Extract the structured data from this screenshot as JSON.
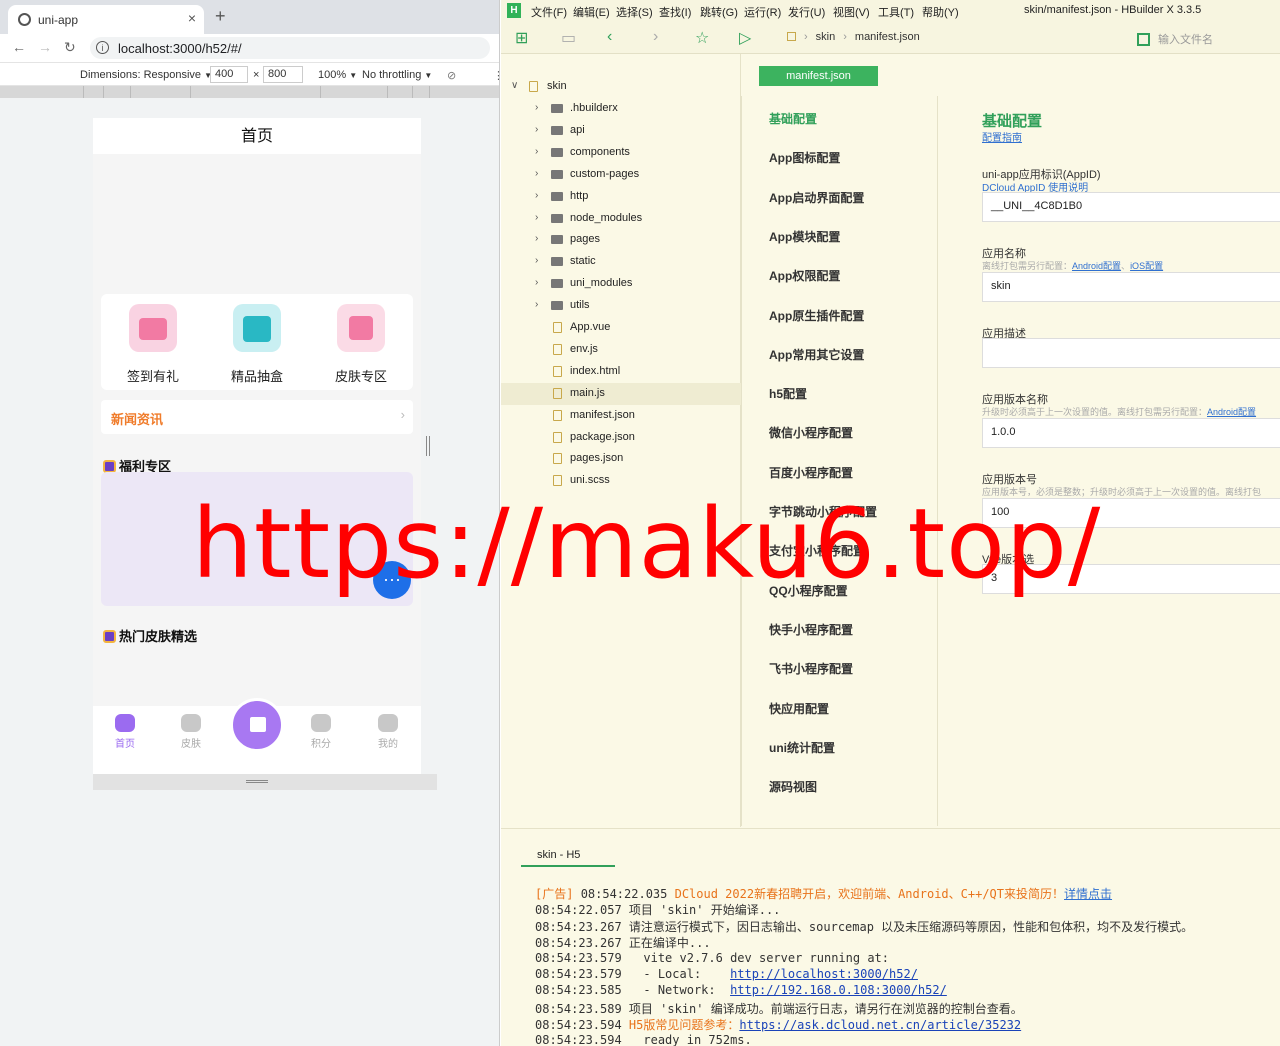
{
  "browser": {
    "tab_title": "uni-app",
    "tab_close": "×",
    "new_tab": "+",
    "url": "localhost:3000/h52/#/",
    "dimensions_label": "Dimensions: Responsive",
    "width": "400",
    "times": "×",
    "height": "800",
    "zoom": "100%",
    "throttle": "No throttling",
    "dropdown_arrow": "▼"
  },
  "phone": {
    "title": "首页",
    "features": [
      {
        "label": "签到有礼",
        "icon": "calendar-gift-icon",
        "color": "#f28cb0"
      },
      {
        "label": "精品抽盒",
        "icon": "gift-box-icon",
        "color": "#29b8c4"
      },
      {
        "label": "皮肤专区",
        "icon": "shopping-cart-icon",
        "color": "#f27aa3"
      }
    ],
    "news": "新闻资讯",
    "news_arrow": "›",
    "welfare": "福利专区",
    "hot_skins": "热门皮肤精选",
    "float_icon": "···",
    "tabs": [
      "首页",
      "皮肤",
      "积分",
      "我的"
    ],
    "accent": "#9b6bf0"
  },
  "hbuilder": {
    "logo": "H",
    "menus": [
      "文件(F)",
      "编辑(E)",
      "选择(S)",
      "查找(I)",
      "跳转(G)",
      "运行(R)",
      "发行(U)",
      "视图(V)",
      "工具(T)",
      "帮助(Y)"
    ],
    "window_title": "skin/manifest.json - HBuilder X 3.3.5",
    "breadcrumb": [
      "skin",
      "manifest.json"
    ],
    "breadcrumb_sep": "›",
    "file_search_placeholder": "输入文件名",
    "tree": {
      "root": "skin",
      "folders": [
        ".hbuilderx",
        "api",
        "components",
        "custom-pages",
        "http",
        "node_modules",
        "pages",
        "static",
        "uni_modules",
        "utils"
      ],
      "files": [
        "App.vue",
        "env.js",
        "index.html",
        "main.js",
        "manifest.json",
        "package.json",
        "pages.json",
        "uni.scss"
      ],
      "selected": "main.js"
    },
    "editor_tab": "manifest.json",
    "nav": [
      "基础配置",
      "App图标配置",
      "App启动界面配置",
      "App模块配置",
      "App权限配置",
      "App原生插件配置",
      "App常用其它设置",
      "h5配置",
      "微信小程序配置",
      "百度小程序配置",
      "字节跳动小程序配置",
      "支付宝小程序配置",
      "QQ小程序配置",
      "快手小程序配置",
      "飞书小程序配置",
      "快应用配置",
      "uni统计配置",
      "源码视图"
    ],
    "form": {
      "title": "基础配置",
      "guide": "配置指南",
      "appid_label": "uni-app应用标识(AppID)",
      "appid_help": "DCloud AppID 使用说明",
      "appid": "__UNI__4C8D1B0",
      "name_label": "应用名称",
      "name_hint": "离线打包需另行配置：",
      "android_link": "Android配置",
      "ios_link": "iOS配置",
      "name": "skin",
      "desc_label": "应用描述",
      "desc": "",
      "version_name_label": "应用版本名称",
      "version_name_hint": "升级时必须高于上一次设置的值。离线打包需另行配置：",
      "android_link2": "Android配置",
      "version_name": "1.0.0",
      "version_code_label": "应用版本号",
      "version_code_hint": "应用版本号，必须是整数；升级时必须高于上一次设置的值。离线打包",
      "version_code": "100",
      "vue_label": "Vue版本选",
      "vue": "3"
    },
    "console_tab": "skin - H5",
    "console": {
      "ad_prefix": "[广告] ",
      "ad_time": "08:54:22.035 ",
      "ad_text": "DCloud 2022新春招聘开启，欢迎前端、Android、C++/QT来投简历！",
      "ad_link": "详情点击",
      "l1": "08:54:22.057 项目 'skin' 开始编译...",
      "l2": "08:54:23.267 请注意运行模式下，因日志输出、sourcemap 以及未压缩源码等原因，性能和包体积，均不及发行模式。",
      "l3": "08:54:23.267 正在编译中...",
      "l4": "08:54:23.579   vite v2.7.6 dev server running at:",
      "l5a": "08:54:23.579   - Local:    ",
      "l5b": "http://localhost:3000/h52/",
      "l6a": "08:54:23.585   - Network:  ",
      "l6b": "http://192.168.0.108:3000/h52/",
      "l7": "08:54:23.589 项目 'skin' 编译成功。前端运行日志，请另行在浏览器的控制台查看。",
      "l8a": "08:54:23.594 ",
      "l8b": "H5版常见问题参考：",
      "l8c": "https://ask.dcloud.net.cn/article/35232",
      "l9": "08:54:23.594   ready in 752ms."
    }
  },
  "watermark": "https://maku6.top/"
}
